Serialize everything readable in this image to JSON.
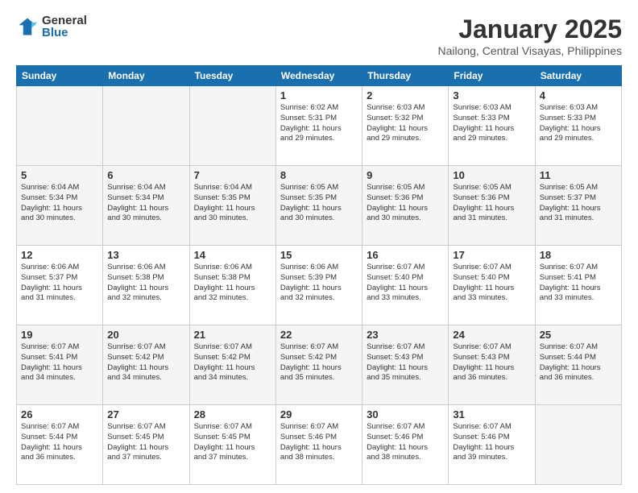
{
  "header": {
    "logo_general": "General",
    "logo_blue": "Blue",
    "month_title": "January 2025",
    "location": "Nailong, Central Visayas, Philippines"
  },
  "days_of_week": [
    "Sunday",
    "Monday",
    "Tuesday",
    "Wednesday",
    "Thursday",
    "Friday",
    "Saturday"
  ],
  "weeks": [
    [
      {
        "day": "",
        "info": ""
      },
      {
        "day": "",
        "info": ""
      },
      {
        "day": "",
        "info": ""
      },
      {
        "day": "1",
        "info": "Sunrise: 6:02 AM\nSunset: 5:31 PM\nDaylight: 11 hours\nand 29 minutes."
      },
      {
        "day": "2",
        "info": "Sunrise: 6:03 AM\nSunset: 5:32 PM\nDaylight: 11 hours\nand 29 minutes."
      },
      {
        "day": "3",
        "info": "Sunrise: 6:03 AM\nSunset: 5:33 PM\nDaylight: 11 hours\nand 29 minutes."
      },
      {
        "day": "4",
        "info": "Sunrise: 6:03 AM\nSunset: 5:33 PM\nDaylight: 11 hours\nand 29 minutes."
      }
    ],
    [
      {
        "day": "5",
        "info": "Sunrise: 6:04 AM\nSunset: 5:34 PM\nDaylight: 11 hours\nand 30 minutes."
      },
      {
        "day": "6",
        "info": "Sunrise: 6:04 AM\nSunset: 5:34 PM\nDaylight: 11 hours\nand 30 minutes."
      },
      {
        "day": "7",
        "info": "Sunrise: 6:04 AM\nSunset: 5:35 PM\nDaylight: 11 hours\nand 30 minutes."
      },
      {
        "day": "8",
        "info": "Sunrise: 6:05 AM\nSunset: 5:35 PM\nDaylight: 11 hours\nand 30 minutes."
      },
      {
        "day": "9",
        "info": "Sunrise: 6:05 AM\nSunset: 5:36 PM\nDaylight: 11 hours\nand 30 minutes."
      },
      {
        "day": "10",
        "info": "Sunrise: 6:05 AM\nSunset: 5:36 PM\nDaylight: 11 hours\nand 31 minutes."
      },
      {
        "day": "11",
        "info": "Sunrise: 6:05 AM\nSunset: 5:37 PM\nDaylight: 11 hours\nand 31 minutes."
      }
    ],
    [
      {
        "day": "12",
        "info": "Sunrise: 6:06 AM\nSunset: 5:37 PM\nDaylight: 11 hours\nand 31 minutes."
      },
      {
        "day": "13",
        "info": "Sunrise: 6:06 AM\nSunset: 5:38 PM\nDaylight: 11 hours\nand 32 minutes."
      },
      {
        "day": "14",
        "info": "Sunrise: 6:06 AM\nSunset: 5:38 PM\nDaylight: 11 hours\nand 32 minutes."
      },
      {
        "day": "15",
        "info": "Sunrise: 6:06 AM\nSunset: 5:39 PM\nDaylight: 11 hours\nand 32 minutes."
      },
      {
        "day": "16",
        "info": "Sunrise: 6:07 AM\nSunset: 5:40 PM\nDaylight: 11 hours\nand 33 minutes."
      },
      {
        "day": "17",
        "info": "Sunrise: 6:07 AM\nSunset: 5:40 PM\nDaylight: 11 hours\nand 33 minutes."
      },
      {
        "day": "18",
        "info": "Sunrise: 6:07 AM\nSunset: 5:41 PM\nDaylight: 11 hours\nand 33 minutes."
      }
    ],
    [
      {
        "day": "19",
        "info": "Sunrise: 6:07 AM\nSunset: 5:41 PM\nDaylight: 11 hours\nand 34 minutes."
      },
      {
        "day": "20",
        "info": "Sunrise: 6:07 AM\nSunset: 5:42 PM\nDaylight: 11 hours\nand 34 minutes."
      },
      {
        "day": "21",
        "info": "Sunrise: 6:07 AM\nSunset: 5:42 PM\nDaylight: 11 hours\nand 34 minutes."
      },
      {
        "day": "22",
        "info": "Sunrise: 6:07 AM\nSunset: 5:42 PM\nDaylight: 11 hours\nand 35 minutes."
      },
      {
        "day": "23",
        "info": "Sunrise: 6:07 AM\nSunset: 5:43 PM\nDaylight: 11 hours\nand 35 minutes."
      },
      {
        "day": "24",
        "info": "Sunrise: 6:07 AM\nSunset: 5:43 PM\nDaylight: 11 hours\nand 36 minutes."
      },
      {
        "day": "25",
        "info": "Sunrise: 6:07 AM\nSunset: 5:44 PM\nDaylight: 11 hours\nand 36 minutes."
      }
    ],
    [
      {
        "day": "26",
        "info": "Sunrise: 6:07 AM\nSunset: 5:44 PM\nDaylight: 11 hours\nand 36 minutes."
      },
      {
        "day": "27",
        "info": "Sunrise: 6:07 AM\nSunset: 5:45 PM\nDaylight: 11 hours\nand 37 minutes."
      },
      {
        "day": "28",
        "info": "Sunrise: 6:07 AM\nSunset: 5:45 PM\nDaylight: 11 hours\nand 37 minutes."
      },
      {
        "day": "29",
        "info": "Sunrise: 6:07 AM\nSunset: 5:46 PM\nDaylight: 11 hours\nand 38 minutes."
      },
      {
        "day": "30",
        "info": "Sunrise: 6:07 AM\nSunset: 5:46 PM\nDaylight: 11 hours\nand 38 minutes."
      },
      {
        "day": "31",
        "info": "Sunrise: 6:07 AM\nSunset: 5:46 PM\nDaylight: 11 hours\nand 39 minutes."
      },
      {
        "day": "",
        "info": ""
      }
    ]
  ]
}
